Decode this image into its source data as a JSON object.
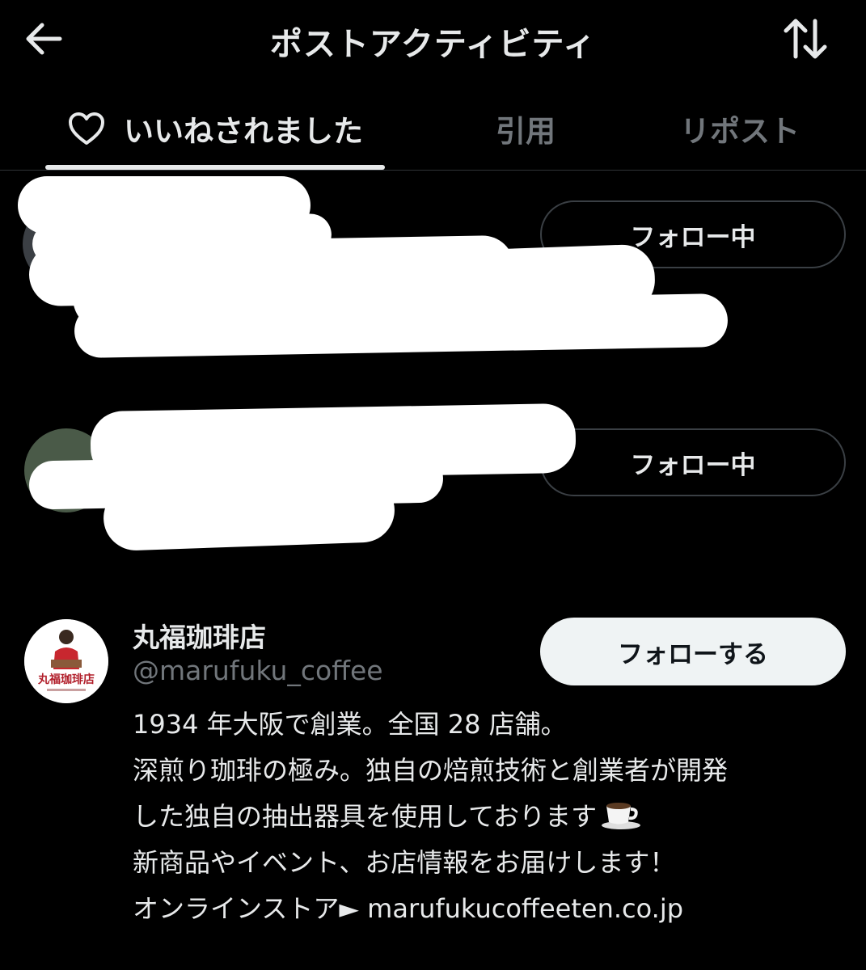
{
  "header": {
    "title": "ポストアクティビティ",
    "back_icon": "arrow-left-icon",
    "sort_icon": "sort-arrows-icon"
  },
  "tabs": [
    {
      "label": "いいねされました",
      "icon": "heart-icon",
      "active": true
    },
    {
      "label": "引用",
      "active": false
    },
    {
      "label": "リポスト",
      "active": false
    }
  ],
  "users": [
    {
      "redacted": true,
      "follow_label": "フォロー中",
      "follow_state": "following"
    },
    {
      "redacted": true,
      "follow_label": "フォロー中",
      "follow_state": "following"
    },
    {
      "display_name": "丸福珈琲店",
      "handle": "@marufuku_coffee",
      "follow_label": "フォローする",
      "follow_state": "not-following",
      "avatar_logo_text": "丸福珈琲店",
      "bio_lines": [
        "1934 年大阪で創業。全国 28 店舗。",
        "深煎り珈琲の極み。独自の焙煎技術と創業者が開発",
        "した独自の抽出器具を使用しております",
        "新商品やイベント、お店情報をお届けします！",
        "オンラインストア► "
      ],
      "bio_link": "marufukucoffeeten.co.jp"
    }
  ],
  "colors": {
    "background": "#000000",
    "text_primary": "#e7e9ea",
    "text_secondary": "#71767b",
    "follow_button_bg": "#eff3f4",
    "divider": "#2f3336"
  }
}
